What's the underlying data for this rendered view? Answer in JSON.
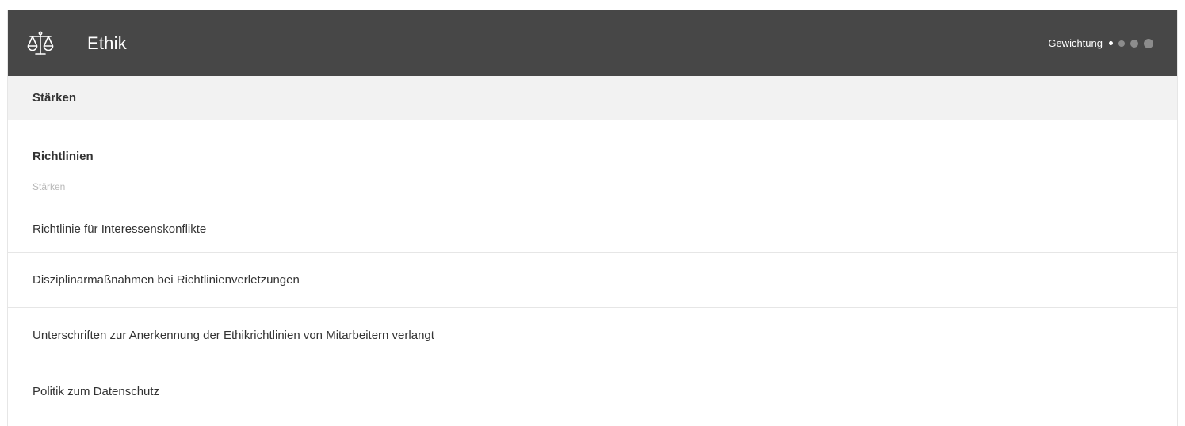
{
  "header": {
    "title": "Ethik",
    "icon": "scales-icon",
    "weight_label": "Gewichtung",
    "weight_level": 1,
    "weight_max": 4,
    "colors": {
      "header_bg": "#474747",
      "dot_active": "#ffffff",
      "dot_inactive": "#8c8c8c"
    }
  },
  "strengths_bar": {
    "label": "Stärken"
  },
  "section": {
    "title": "Richtlinien",
    "subtitle": "Stärken",
    "items": [
      {
        "label": "Richtlinie für Interessenskonflikte"
      },
      {
        "label": "Disziplinarmaßnahmen bei Richtlinienverletzungen"
      },
      {
        "label": "Unterschriften zur Anerkennung der Ethikrichtlinien von Mitarbeitern verlangt"
      },
      {
        "label": "Politik zum Datenschutz"
      }
    ]
  }
}
